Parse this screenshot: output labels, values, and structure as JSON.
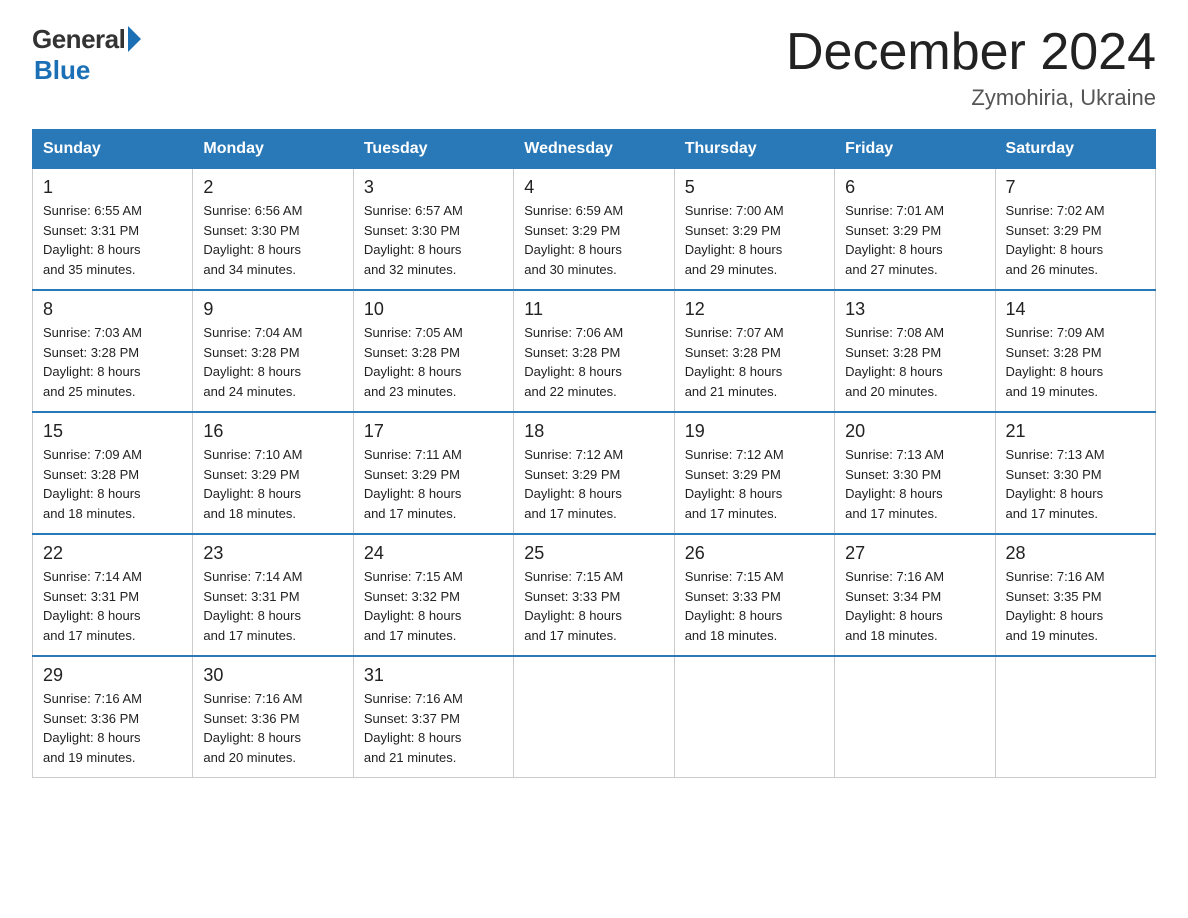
{
  "logo": {
    "general": "General",
    "blue": "Blue"
  },
  "title": "December 2024",
  "location": "Zymohiria, Ukraine",
  "days_of_week": [
    "Sunday",
    "Monday",
    "Tuesday",
    "Wednesday",
    "Thursday",
    "Friday",
    "Saturday"
  ],
  "weeks": [
    [
      {
        "day": "1",
        "sunrise": "6:55 AM",
        "sunset": "3:31 PM",
        "daylight": "8 hours and 35 minutes."
      },
      {
        "day": "2",
        "sunrise": "6:56 AM",
        "sunset": "3:30 PM",
        "daylight": "8 hours and 34 minutes."
      },
      {
        "day": "3",
        "sunrise": "6:57 AM",
        "sunset": "3:30 PM",
        "daylight": "8 hours and 32 minutes."
      },
      {
        "day": "4",
        "sunrise": "6:59 AM",
        "sunset": "3:29 PM",
        "daylight": "8 hours and 30 minutes."
      },
      {
        "day": "5",
        "sunrise": "7:00 AM",
        "sunset": "3:29 PM",
        "daylight": "8 hours and 29 minutes."
      },
      {
        "day": "6",
        "sunrise": "7:01 AM",
        "sunset": "3:29 PM",
        "daylight": "8 hours and 27 minutes."
      },
      {
        "day": "7",
        "sunrise": "7:02 AM",
        "sunset": "3:29 PM",
        "daylight": "8 hours and 26 minutes."
      }
    ],
    [
      {
        "day": "8",
        "sunrise": "7:03 AM",
        "sunset": "3:28 PM",
        "daylight": "8 hours and 25 minutes."
      },
      {
        "day": "9",
        "sunrise": "7:04 AM",
        "sunset": "3:28 PM",
        "daylight": "8 hours and 24 minutes."
      },
      {
        "day": "10",
        "sunrise": "7:05 AM",
        "sunset": "3:28 PM",
        "daylight": "8 hours and 23 minutes."
      },
      {
        "day": "11",
        "sunrise": "7:06 AM",
        "sunset": "3:28 PM",
        "daylight": "8 hours and 22 minutes."
      },
      {
        "day": "12",
        "sunrise": "7:07 AM",
        "sunset": "3:28 PM",
        "daylight": "8 hours and 21 minutes."
      },
      {
        "day": "13",
        "sunrise": "7:08 AM",
        "sunset": "3:28 PM",
        "daylight": "8 hours and 20 minutes."
      },
      {
        "day": "14",
        "sunrise": "7:09 AM",
        "sunset": "3:28 PM",
        "daylight": "8 hours and 19 minutes."
      }
    ],
    [
      {
        "day": "15",
        "sunrise": "7:09 AM",
        "sunset": "3:28 PM",
        "daylight": "8 hours and 18 minutes."
      },
      {
        "day": "16",
        "sunrise": "7:10 AM",
        "sunset": "3:29 PM",
        "daylight": "8 hours and 18 minutes."
      },
      {
        "day": "17",
        "sunrise": "7:11 AM",
        "sunset": "3:29 PM",
        "daylight": "8 hours and 17 minutes."
      },
      {
        "day": "18",
        "sunrise": "7:12 AM",
        "sunset": "3:29 PM",
        "daylight": "8 hours and 17 minutes."
      },
      {
        "day": "19",
        "sunrise": "7:12 AM",
        "sunset": "3:29 PM",
        "daylight": "8 hours and 17 minutes."
      },
      {
        "day": "20",
        "sunrise": "7:13 AM",
        "sunset": "3:30 PM",
        "daylight": "8 hours and 17 minutes."
      },
      {
        "day": "21",
        "sunrise": "7:13 AM",
        "sunset": "3:30 PM",
        "daylight": "8 hours and 17 minutes."
      }
    ],
    [
      {
        "day": "22",
        "sunrise": "7:14 AM",
        "sunset": "3:31 PM",
        "daylight": "8 hours and 17 minutes."
      },
      {
        "day": "23",
        "sunrise": "7:14 AM",
        "sunset": "3:31 PM",
        "daylight": "8 hours and 17 minutes."
      },
      {
        "day": "24",
        "sunrise": "7:15 AM",
        "sunset": "3:32 PM",
        "daylight": "8 hours and 17 minutes."
      },
      {
        "day": "25",
        "sunrise": "7:15 AM",
        "sunset": "3:33 PM",
        "daylight": "8 hours and 17 minutes."
      },
      {
        "day": "26",
        "sunrise": "7:15 AM",
        "sunset": "3:33 PM",
        "daylight": "8 hours and 18 minutes."
      },
      {
        "day": "27",
        "sunrise": "7:16 AM",
        "sunset": "3:34 PM",
        "daylight": "8 hours and 18 minutes."
      },
      {
        "day": "28",
        "sunrise": "7:16 AM",
        "sunset": "3:35 PM",
        "daylight": "8 hours and 19 minutes."
      }
    ],
    [
      {
        "day": "29",
        "sunrise": "7:16 AM",
        "sunset": "3:36 PM",
        "daylight": "8 hours and 19 minutes."
      },
      {
        "day": "30",
        "sunrise": "7:16 AM",
        "sunset": "3:36 PM",
        "daylight": "8 hours and 20 minutes."
      },
      {
        "day": "31",
        "sunrise": "7:16 AM",
        "sunset": "3:37 PM",
        "daylight": "8 hours and 21 minutes."
      },
      null,
      null,
      null,
      null
    ]
  ],
  "labels": {
    "sunrise": "Sunrise:",
    "sunset": "Sunset:",
    "daylight": "Daylight:"
  }
}
